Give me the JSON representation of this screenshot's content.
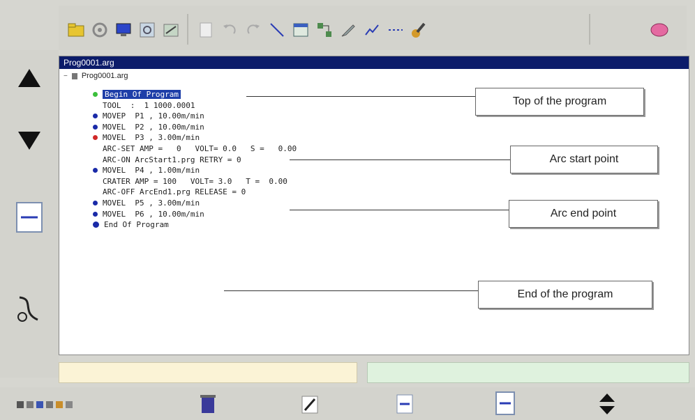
{
  "window": {
    "title": "Prog0001.arg"
  },
  "tree": {
    "root_label": "Prog0001.arg"
  },
  "program_lines": [
    {
      "text": "Begin Of Program",
      "dot_color": "#3bbf3b",
      "highlight": true,
      "dot": true
    },
    {
      "text": "TOOL  :  1 1000.0001",
      "dot": false
    },
    {
      "text": "MOVEP  P1 , 10.00m/min",
      "dot_color": "#1a2aa8",
      "dot": true
    },
    {
      "text": "MOVEL  P2 , 10.00m/min",
      "dot_color": "#1a2aa8",
      "dot": true
    },
    {
      "text": "MOVEL  P3 , 3.00m/min",
      "dot_color": "#d02828",
      "dot": true
    },
    {
      "text": "ARC-SET AMP =   0   VOLT= 0.0   S =   0.00",
      "dot": false
    },
    {
      "text": "ARC-ON ArcStart1.prg RETRY = 0",
      "dot": false
    },
    {
      "text": "MOVEL  P4 , 1.00m/min",
      "dot_color": "#1a2aa8",
      "dot": true
    },
    {
      "text": "CRATER AMP = 100   VOLT= 3.0   T =  0.00",
      "dot": false
    },
    {
      "text": "ARC-OFF ArcEnd1.prg RELEASE = 0",
      "dot": false
    },
    {
      "text": "MOVEL  P5 , 3.00m/min",
      "dot_color": "#1a2aa8",
      "dot": true
    },
    {
      "text": "MOVEL  P6 , 10.00m/min",
      "dot_color": "#1a2aa8",
      "dot": true
    },
    {
      "text": "End Of Program",
      "dot_color": "#1a2aa8",
      "dot": true,
      "big_dot": true
    }
  ],
  "callouts": {
    "top": "Top of the program",
    "arc_start": "Arc start point",
    "arc_end": "Arc end point",
    "end": "End of the program"
  },
  "colors": {
    "title_bar": "#0c1c6a",
    "selection": "#1e3ea8",
    "status_yellow": "#fbf3d6",
    "status_green": "#dff2de"
  },
  "icons": {
    "toolbar": [
      "folder-icon",
      "gear-icon",
      "monitor-icon",
      "settings-icon",
      "gauge-icon",
      "file-icon",
      "undo-icon",
      "redo-icon",
      "line-icon",
      "window-icon",
      "network-icon",
      "pen-icon",
      "plot-icon",
      "dotted-line-icon",
      "robot-icon",
      "eraser-icon"
    ],
    "left": [
      "up-arrow-icon",
      "down-arrow-icon",
      "page-icon",
      "arc-icon"
    ],
    "bottom": [
      "grid-icon",
      "trash-icon",
      "edit-icon",
      "insert-icon",
      "page-icon",
      "updown-icon"
    ]
  }
}
